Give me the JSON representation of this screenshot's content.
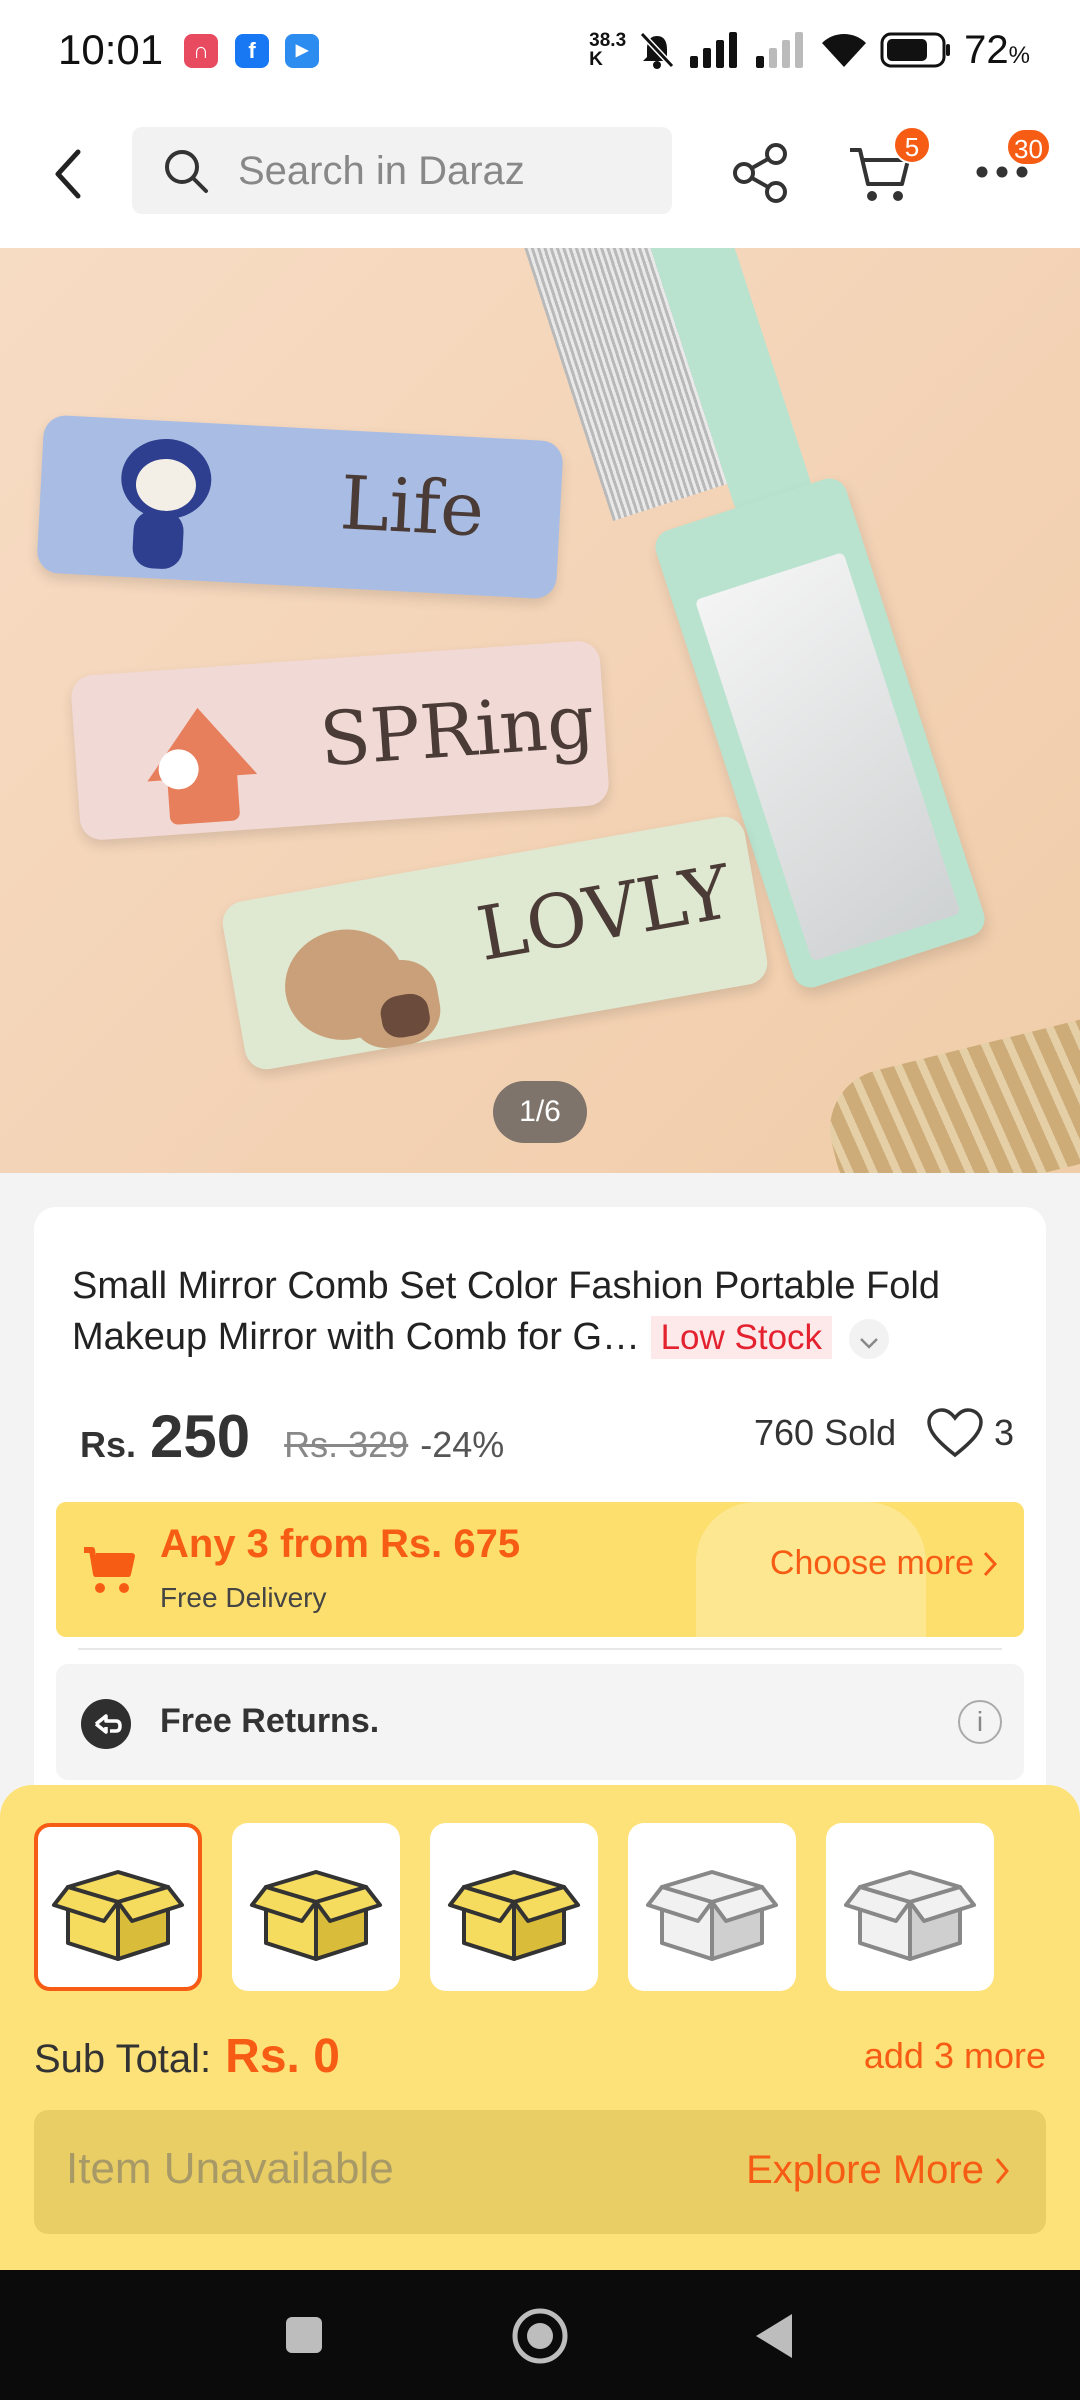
{
  "status_bar": {
    "time": "10:01",
    "apps": [
      {
        "icon": "headphones-app-icon",
        "color": "#e84a5f",
        "glyph": "∩"
      },
      {
        "icon": "facebook-app-icon",
        "color": "#1877f2",
        "glyph": "f"
      },
      {
        "icon": "media-app-icon",
        "color": "#2d8cf0",
        "glyph": "▶"
      }
    ],
    "data_rate_value": "38.3",
    "data_rate_unit": "K",
    "battery": "72",
    "battery_unit": "%"
  },
  "nav": {
    "search_placeholder": "Search in Daraz",
    "cart_badge": "5",
    "more_badge": "30",
    "icons": [
      "back-arrow-icon",
      "search-icon",
      "share-icon",
      "cart-icon",
      "more-icon"
    ]
  },
  "gallery": {
    "counter": "1/6",
    "comb_words": [
      "Life",
      "SPRing",
      "LOVLY"
    ]
  },
  "product": {
    "title": "Small Mirror Comb Set Color Fashion Portable Fold Makeup Mirror with Comb for G…",
    "stock_badge": "Low Stock",
    "currency": "Rs.",
    "price": "250",
    "original_price": "Rs. 329",
    "discount": "-24%",
    "sold": "760 Sold",
    "likes": "3"
  },
  "promo": {
    "headline": "Any 3 from Rs. 675",
    "subline": "Free Delivery",
    "link": "Choose more"
  },
  "returns": {
    "label": "Free Returns.",
    "info": "i"
  },
  "bundle": {
    "boxes": [
      {
        "state": "selected",
        "color": "yellow"
      },
      {
        "state": "normal",
        "color": "yellow"
      },
      {
        "state": "normal",
        "color": "yellow"
      },
      {
        "state": "empty",
        "color": "grey"
      },
      {
        "state": "empty",
        "color": "grey"
      }
    ],
    "subtotal_label": "Sub Total:",
    "subtotal_value": "Rs. 0",
    "add_more": "add 3 more",
    "cta_label": "Item Unavailable",
    "cta_link": "Explore More"
  },
  "colors": {
    "accent": "#f75c14",
    "promo_bg": "#fddf6d",
    "stock_red": "#e3212f"
  }
}
